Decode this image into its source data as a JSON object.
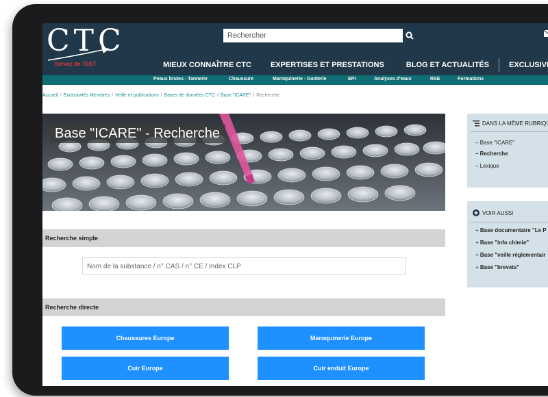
{
  "header": {
    "logo_text": "CTC",
    "logo_tagline": "Servez de TEST",
    "search_placeholder": "Rechercher",
    "main_nav": [
      "MIEUX CONNAÎTRE CTC",
      "EXPERTISES ET PRESTATIONS",
      "BLOG ET ACTUALITÉS",
      "EXCLUSIVITÉS MEMBRES"
    ],
    "sub_nav": [
      "Peaux brutes - Tannerie",
      "Chaussure",
      "Maroquinerie - Ganterie",
      "EPI",
      "Analyses d'eaux",
      "RSE",
      "Formations"
    ]
  },
  "breadcrumb": {
    "items": [
      "Accueil",
      "Exclusivités Membres",
      "Veille et publications",
      "Bases de données CTC",
      "Base \"ICARE\""
    ],
    "current": "Recherche"
  },
  "banner": {
    "title": "Base \"ICARE\" - Recherche"
  },
  "simple_search": {
    "heading": "Recherche simple",
    "placeholder": "Nom de la substance / n° CAS / n° CE / Index CLP"
  },
  "direct_search": {
    "heading": "Recherche directe",
    "buttons": [
      "Chaussures Europe",
      "Maroquinerie Europe",
      "Cuir Europe",
      "Cuir enduit Europe"
    ]
  },
  "sidebar": {
    "same_section": {
      "heading": "DANS LA MÊME RUBRIQUE",
      "items": [
        "Base \"ICARE\"",
        "Recherche",
        "Lexique"
      ]
    },
    "see_also": {
      "heading": "VOIR AUSSI",
      "items": [
        "Base documentaire \"Le P",
        "Base \"info chimie\"",
        "Base \"veille réglementair",
        "Base \"brevets\""
      ]
    }
  },
  "colors": {
    "header_bg": "#203849",
    "subnav_bg": "#0e6e73",
    "button_blue": "#1e90ff",
    "sidebar_bg": "#d5e1e8"
  }
}
